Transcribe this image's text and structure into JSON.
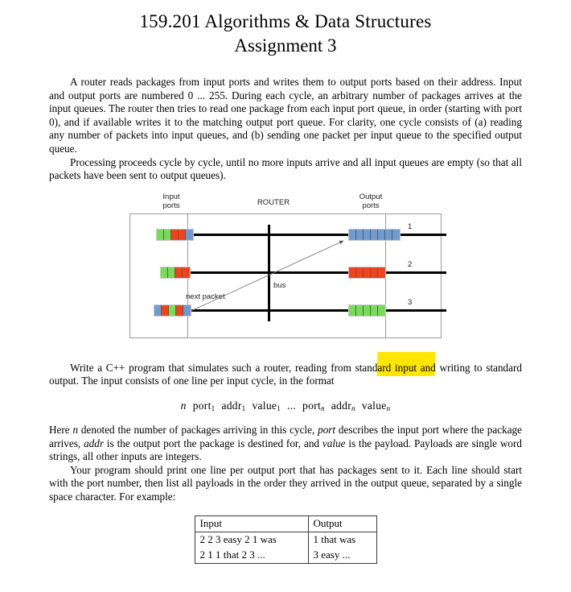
{
  "title": {
    "line1": "159.201 Algorithms & Data Structures",
    "line2": "Assignment 3"
  },
  "paragraphs": {
    "p1": "A router reads packages from input ports and writes them to output ports based on their address. Input and output ports are numbered 0 ... 255. During each cycle, an arbitrary number of packages arrives at the input queues. The router then tries to read one package from each input port queue, in order (starting with port 0), and if available writes it to the matching output port queue. For clarity, one cycle consists of (a) reading any number of packets into input queues, and (b) sending one packet per input queue to the specified output queue.",
    "p2": "Processing proceeds cycle by cycle, until no more inputs arrive and all input queues are empty (so that all packets have been sent to output queues).",
    "p3": "Write a C++ program that simulates such a router, reading from standard input and writing to standard output. The input consists of one line per input cycle, in the format",
    "p4_pre": "Here ",
    "p4_n": "n",
    "p4_a": " denoted the number of packages arriving in this cycle, ",
    "p4_port": "port",
    "p4_b": " describes the input port where the package arrives, ",
    "p4_addr": "addr",
    "p4_c": " is the output port the package is destined for, and ",
    "p4_value": "value",
    "p4_d": " is the payload. Payloads are single word strings, all other inputs are integers.",
    "p5": "Your program should print one line per output port that has packages sent to it. Each line should start with the port number, then list all payloads in the order they arrived in the output queue, separated by a single space character. For example:"
  },
  "formula": {
    "n": "n",
    "t1": "port",
    "s1": "1",
    "t2": "addr",
    "s2": "1",
    "t3": "value",
    "s3": "1",
    "ellipsis": "...",
    "t4": "port",
    "s4": "n",
    "t5": "addr",
    "s5": "n",
    "t6": "value",
    "s6": "n"
  },
  "figure": {
    "label_input": "Input\nports",
    "label_input_l1": "Input",
    "label_input_l2": "ports",
    "label_router": "ROUTER",
    "label_output_l1": "Output",
    "label_output_l2": "ports",
    "label_bus": "bus",
    "label_next_packet": "next packet",
    "port_numbers": [
      "1",
      "2",
      "3"
    ],
    "colors": {
      "green": "#77dd55",
      "red": "#f5411a",
      "blue": "#6e9bd1",
      "queue_frame": "#c9c9c9",
      "cell_divider": "#5c5c5c",
      "line": "#000000",
      "box_border": "#9a9a9a"
    },
    "input_queues": [
      [
        "green",
        "green",
        "red",
        "red",
        "blue"
      ],
      [
        "green",
        "green",
        "red",
        "red"
      ],
      [
        "blue",
        "red",
        "green",
        "red",
        "blue"
      ]
    ],
    "output_queues": [
      [
        "blue",
        "blue",
        "blue",
        "blue",
        "blue",
        "blue",
        "blue"
      ],
      [
        "red",
        "red",
        "red",
        "red",
        "red"
      ],
      [
        "green",
        "green",
        "green",
        "green",
        "green"
      ]
    ]
  },
  "highlight": {
    "color": "#ffe600"
  },
  "example_table": {
    "headers": [
      "Input",
      "Output"
    ],
    "rows": [
      [
        "2 2 3 easy 2 1 was",
        "1 that was"
      ],
      [
        "2 1 1 that 2 3 ...",
        "3 easy ..."
      ]
    ]
  }
}
